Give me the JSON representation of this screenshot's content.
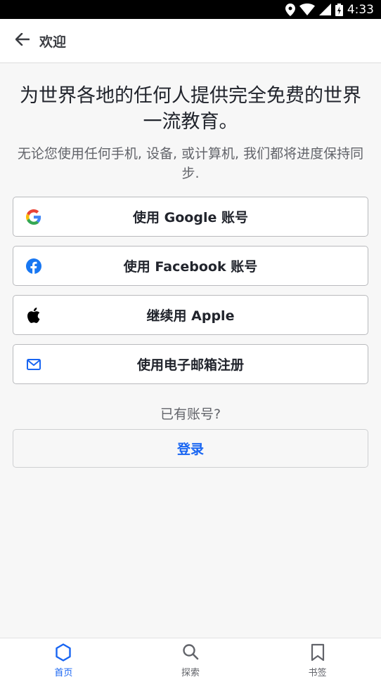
{
  "status_bar": {
    "time": "4:33"
  },
  "header": {
    "title": "欢迎"
  },
  "main": {
    "headline": "为世界各地的任何人提供完全免费的世界一流教育。",
    "subtext": "无论您使用任何手机, 设备, 或计算机, 我们都将进度保持同步.",
    "auth_buttons": [
      {
        "label": "使用 Google 账号",
        "icon": "google-icon"
      },
      {
        "label": "使用 Facebook 账号",
        "icon": "facebook-icon"
      },
      {
        "label": "继续用 Apple",
        "icon": "apple-icon"
      },
      {
        "label": "使用电子邮箱注册",
        "icon": "mail-icon"
      }
    ],
    "have_account": "已有账号?",
    "login_label": "登录"
  },
  "bottom_nav": {
    "items": [
      {
        "label": "首页",
        "icon": "home-hexagon-icon",
        "active": true
      },
      {
        "label": "探索",
        "icon": "search-icon",
        "active": false
      },
      {
        "label": "书签",
        "icon": "bookmark-icon",
        "active": false
      }
    ]
  },
  "colors": {
    "accent": "#1865f2",
    "facebook": "#1877f2",
    "text_primary": "#21242c",
    "text_secondary": "#62646a",
    "background": "#f7f7f7"
  }
}
